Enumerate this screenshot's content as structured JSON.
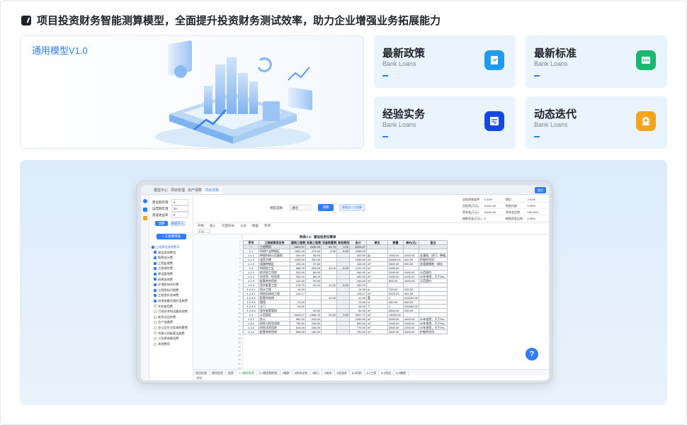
{
  "header": {
    "title": "项目投资财务智能测算模型，全面提升投资财务测试效率，助力企业增强业务拓展能力"
  },
  "hero": {
    "version": "通用模型V1.0"
  },
  "cards": [
    {
      "title": "最新政策",
      "subtitle": "Bank Loans",
      "icon": "policy-icon",
      "color": "#1e9bf0"
    },
    {
      "title": "最新标准",
      "subtitle": "Bank Loans",
      "icon": "standard-icon",
      "color": "#19b86f"
    },
    {
      "title": "经验实务",
      "subtitle": "Bank Loans",
      "icon": "practice-icon",
      "color": "#1447e6"
    },
    {
      "title": "动态迭代",
      "subtitle": "Bank Loans",
      "icon": "iterate-icon",
      "color": "#f5a41b"
    }
  ],
  "app": {
    "tabs": [
      "模型中心",
      "项目管理",
      "资产测算",
      "项目测算"
    ],
    "left_fields": [
      {
        "label": "建设期年限",
        "value": "2"
      },
      {
        "label": "运营期年限",
        "value": "15"
      },
      {
        "label": "基准收益率",
        "value": "5"
      }
    ],
    "calc_button": "测算",
    "clear_button": "数据导入",
    "add_button": "+ 工程费用类",
    "tree": [
      "工程建设其他费用",
      "建设用地费用",
      "勘察设计费",
      "工程监理费",
      "工程保险费",
      "建设管理费",
      "前期咨询费",
      "环境影响评价费",
      "工程招标代理费",
      "工程造价咨询费",
      "场地准备及临时设施费",
      "专利使用费",
      "引进技术和设备其他费",
      "联合试运转费",
      "生产准备费",
      "办公及生活家具购置费",
      "市政公用配套设施费",
      "人防易地建设费",
      "其他费用"
    ],
    "top_center": {
      "select_label": "地区选择",
      "select_value": "湖北",
      "primary_button": "测算",
      "secondary_button": "数据导入与测算"
    },
    "stats": [
      [
        "总投资收益率",
        "5.41%",
        "税后",
        "2.01%"
      ],
      [
        "总投资(万元)",
        "11631.00",
        "财务内部",
        "0.00%"
      ],
      [
        "资本金(万元)",
        "11631.00",
        "资本金比例",
        "100.00%"
      ],
      [
        "借款资金(万元)",
        "0",
        "借款资金比例",
        "0.00%"
      ]
    ],
    "toolbar": [
      "开始",
      "插入",
      "页面布局",
      "公式",
      "数据",
      "审阅"
    ],
    "cell_ref": "F16",
    "table_title": "附表1-1：建设投资估算表",
    "table_header": [
      "序号",
      "工程或费用名称",
      "建筑工程费",
      "安装工程费",
      "设备购置费",
      "其他费用",
      "合计",
      "单位",
      "数量",
      "单价(元)",
      "备注"
    ],
    "rows": [
      [
        "一",
        "工程费用",
        "4829.37",
        "2636.25",
        "59.75",
        "0.00",
        "8025.37",
        "",
        "",
        "",
        ""
      ],
      [
        "1.1",
        "科研产业种植区",
        "1834.40",
        "473.60",
        "5.50",
        "5.50",
        "2308.00",
        "",
        "",
        "",
        ""
      ],
      [
        "1.1.1",
        "种植科研示范基地",
        "304.00",
        "96.00",
        "",
        "",
        "400.00",
        "亩",
        "1000.00",
        "2000.00",
        "含灌溉、排污、种植、施肥"
      ],
      [
        "1.1.2",
        "温室大棚",
        "1200.00",
        "330.00",
        "",
        "",
        "1530.00",
        "m²",
        "40000.00",
        "400.00",
        "护坡的空间"
      ],
      [
        "1.1.3",
        "道路种植区",
        "126.40",
        "37.60",
        "",
        "",
        "164.00",
        "m²",
        "3000.00",
        "550.00",
        "含道路铺装、绿化"
      ],
      [
        "1.2",
        "科研加工区",
        "968.70",
        "205.00",
        "41.00",
        "6.00",
        "1220.70",
        "m²",
        "4000.00",
        "",
        ""
      ],
      [
        "1.2.1",
        "综合加工用房",
        "320.00",
        "80.00",
        "",
        "",
        "400.00",
        "m²",
        "2000.00",
        "2000.00",
        "示范园内"
      ],
      [
        "1.2.2",
        "实验室、检验室",
        "352.00",
        "88.00",
        "",
        "",
        "440.00",
        "m²",
        "2000.00",
        "2200.00",
        "30年使用，大于5m，其高计算"
      ],
      [
        "1.2.3",
        "配套库房用房",
        "120.00",
        "30.00",
        "",
        "",
        "150.00",
        "m²",
        "600.00",
        "2500.00",
        "示范园内"
      ],
      [
        "1.2.4",
        "室外配套工程",
        "176.70",
        "92.00",
        "41.00",
        "6.00",
        "300.70",
        "",
        "",
        "",
        ""
      ],
      [
        "1.2.4.1",
        "给水工程",
        "14.20",
        "",
        "",
        "",
        "14.20",
        "m",
        "700.00",
        "200.00",
        ""
      ],
      [
        "1.2.4.2",
        "场地及绿化工程",
        "126.17",
        "",
        "",
        "",
        "126.17",
        "m²",
        "2623.33",
        "481.00",
        ""
      ],
      [
        "1.2.4.3",
        "配套供电线",
        "",
        "",
        "41.00",
        "",
        "41.00",
        "套",
        "1",
        "410000.00",
        ""
      ],
      [
        "1.2.4.4",
        "围墙",
        "23.43",
        "",
        "",
        "",
        "23.43",
        "m",
        "350.00",
        "900.00",
        ""
      ],
      [
        "1.2.4.5",
        "大门",
        "25.00",
        "",
        "",
        "",
        "25.00",
        "个",
        "1",
        "250000.00",
        ""
      ],
      [
        "1.2.4.6",
        "室外配套管网",
        "",
        "92.00",
        "",
        "",
        "92.00",
        "m²",
        "4600.00",
        "200.00",
        ""
      ],
      [
        "1.3",
        "示范园区",
        "2026.27",
        "1958.75",
        "20.00",
        "3.00",
        "4007.77",
        "m²",
        "14000.00",
        "",
        ""
      ],
      [
        "1.3.1",
        "办公",
        "960.00",
        "240.00",
        "",
        "",
        "1200.00",
        "m²",
        "3000.00",
        "4000.00",
        "30年使用，大于5m，其高计算"
      ],
      [
        "1.3.2",
        "研发与检验用房",
        "792.00",
        "198.00",
        "",
        "",
        "990.00",
        "m²",
        "3000.00",
        "3300.00",
        "30年使用，大于5m，其高计算"
      ],
      [
        "1.3.3",
        "研发试验用房",
        "616.00",
        "154.00",
        "",
        "",
        "770.00",
        "m²",
        "3500.00",
        "2200.00",
        "30年使用，大于5m，其高计算"
      ],
      [
        "1.3.4",
        "配套库房用房",
        "568.00",
        "182.00",
        "",
        "",
        "750.00",
        "m²",
        "3000.00",
        "2500.00",
        "护坡的空间"
      ]
    ],
    "sheet_tabs": [
      "项目信息",
      "建设投资",
      "投资",
      "1-1建设投资",
      "1-2建设期利息",
      "2借款",
      "3资本计划",
      "4收入",
      "5成本",
      "6总成本",
      "6-1利润",
      "6-2工资",
      "6-3折旧",
      "6-4摊销"
    ],
    "status_text": "就绪"
  }
}
